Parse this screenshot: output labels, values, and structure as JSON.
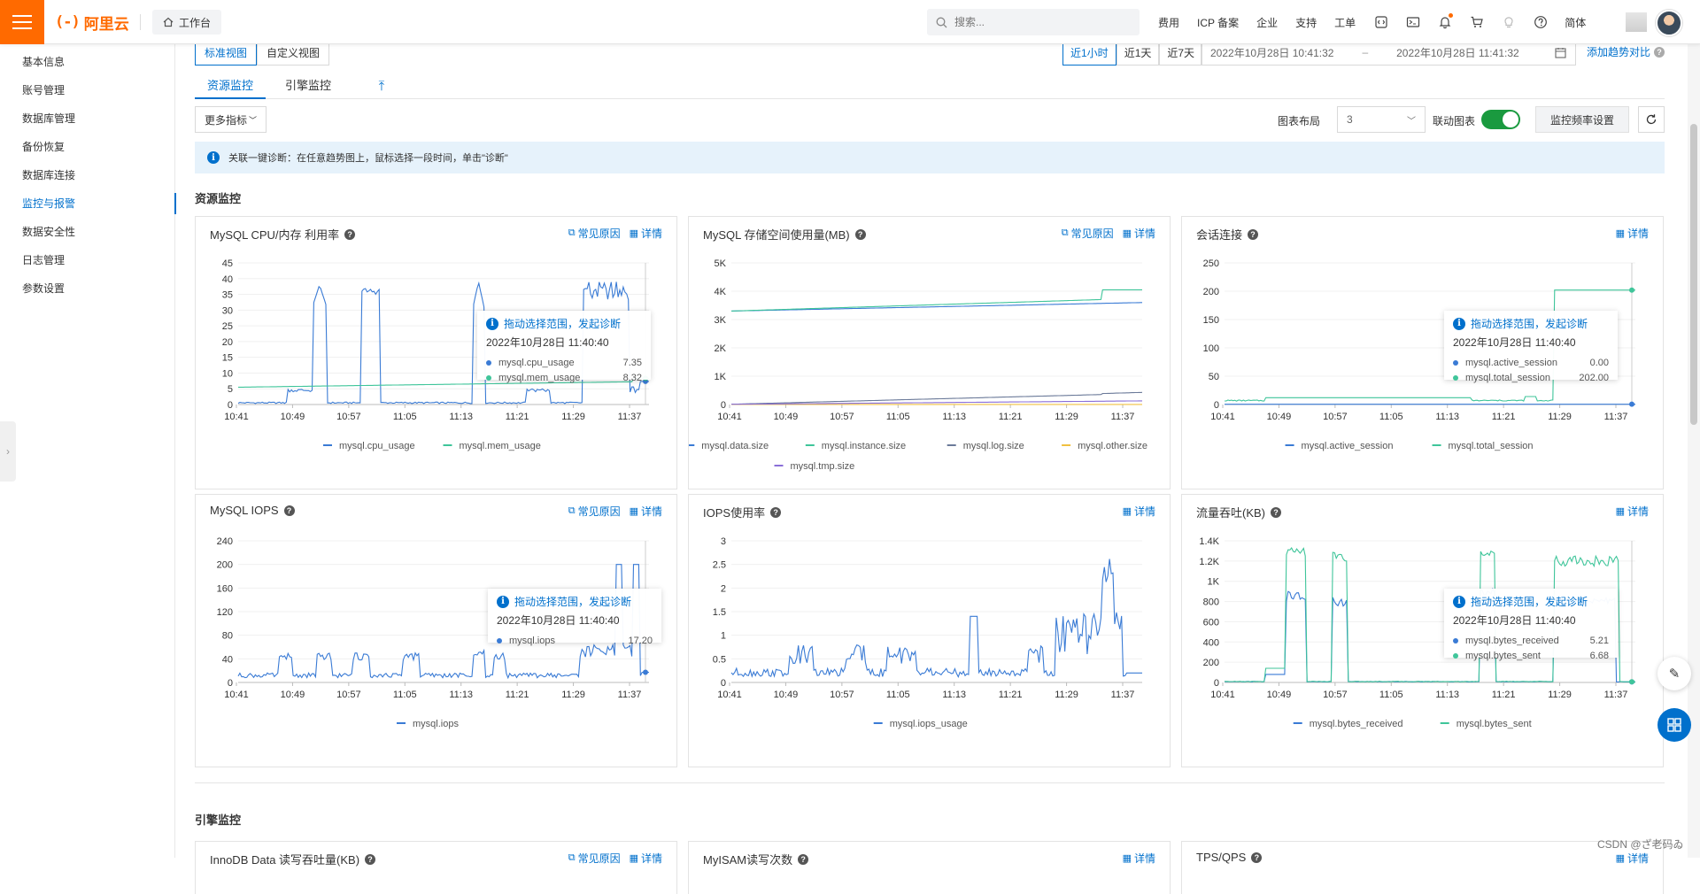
{
  "topbar": {
    "logo_mark": "(-)",
    "logo_text": "阿里云",
    "workbench": "工作台",
    "search_placeholder": "搜索...",
    "nav": [
      "费用",
      "ICP 备案",
      "企业",
      "支持",
      "工单"
    ],
    "lang": "简体",
    "icons": [
      "code-icon",
      "terminal-icon",
      "bell-icon",
      "cart-icon",
      "bulb-icon",
      "help-icon"
    ]
  },
  "sidebar": {
    "items": [
      {
        "label": "基本信息",
        "active": false
      },
      {
        "label": "账号管理",
        "active": false
      },
      {
        "label": "数据库管理",
        "active": false
      },
      {
        "label": "备份恢复",
        "active": false
      },
      {
        "label": "数据库连接",
        "active": false
      },
      {
        "label": "监控与报警",
        "active": true
      },
      {
        "label": "数据安全性",
        "active": false
      },
      {
        "label": "日志管理",
        "active": false
      },
      {
        "label": "参数设置",
        "active": false
      }
    ]
  },
  "toolbar": {
    "views": [
      "标准视图",
      "自定义视图"
    ],
    "time_ranges": [
      "近1小时",
      "近1天",
      "近7天"
    ],
    "date_start": "2022年10月28日 10:41:32",
    "date_sep": "–",
    "date_end": "2022年10月28日 11:41:32",
    "trend_compare": "添加趋势对比",
    "tabs": [
      "资源监控",
      "引擎监控"
    ],
    "more_metrics": "更多指标",
    "layout_label": "图表布局",
    "layout_value": "3",
    "link_chart_label": "联动图表",
    "link_chart_on": true,
    "freq_btn": "监控频率设置"
  },
  "notice": "关联一键诊断：在任意趋势图上，鼠标选择一段时间，单击\"诊断\"",
  "sections": {
    "resource": "资源监控",
    "engine": "引擎监控"
  },
  "common_link": "常见原因",
  "detail_link": "详情",
  "tooltip_title": "拖动选择范围，发起诊断",
  "tooltip_time": "2022年10月28日 11:40:40",
  "x_ticks": [
    "10:41",
    "10:49",
    "10:57",
    "11:05",
    "11:13",
    "11:21",
    "11:29",
    "11:37"
  ],
  "colors": {
    "blue": "#3a7bd5",
    "teal": "#3fc59a",
    "slate": "#6b7a99",
    "yellow": "#f0c040",
    "purple": "#8a6fd8",
    "accent": "#0070cc",
    "brand": "#ff6a00"
  },
  "chart_data": [
    {
      "id": "cpu",
      "type": "line",
      "title": "MySQL CPU/内存 利用率",
      "has_common": true,
      "ylim": [
        0,
        45
      ],
      "yticks": [
        "0",
        "5",
        "10",
        "15",
        "20",
        "25",
        "30",
        "35",
        "40",
        "45"
      ],
      "yvals": [
        0,
        5,
        10,
        15,
        20,
        25,
        30,
        35,
        40,
        45
      ],
      "series": [
        {
          "name": "mysql.cpu_usage",
          "color": "blue",
          "kind": "cpu"
        },
        {
          "name": "mysql.mem_usage",
          "color": "teal",
          "kind": "mem"
        }
      ],
      "tooltip": [
        {
          "name": "mysql.cpu_usage",
          "value": "7.35",
          "color": "blue"
        },
        {
          "name": "mysql.mem_usage",
          "value": "8.32",
          "color": "teal"
        }
      ]
    },
    {
      "id": "storage",
      "type": "line",
      "title": "MySQL 存储空间使用量(MB)",
      "has_common": true,
      "ylim": [
        0,
        5000
      ],
      "yticks": [
        "0",
        "1K",
        "2K",
        "3K",
        "4K",
        "5K"
      ],
      "yvals": [
        0,
        1000,
        2000,
        3000,
        4000,
        5000
      ],
      "series": [
        {
          "name": "mysql.data.size",
          "color": "blue",
          "kind": "data"
        },
        {
          "name": "mysql.instance.size",
          "color": "teal",
          "kind": "inst"
        },
        {
          "name": "mysql.log.size",
          "color": "slate",
          "kind": "log"
        },
        {
          "name": "mysql.other.size",
          "color": "yellow",
          "kind": "other"
        },
        {
          "name": "mysql.tmp.size",
          "color": "purple",
          "kind": "tmp"
        }
      ],
      "tooltip": []
    },
    {
      "id": "session",
      "type": "line",
      "title": "会话连接",
      "has_common": false,
      "ylim": [
        0,
        250
      ],
      "yticks": [
        "0",
        "50",
        "100",
        "150",
        "200",
        "250"
      ],
      "yvals": [
        0,
        50,
        100,
        150,
        200,
        250
      ],
      "series": [
        {
          "name": "mysql.active_session",
          "color": "blue",
          "kind": "active"
        },
        {
          "name": "mysql.total_session",
          "color": "teal",
          "kind": "total"
        }
      ],
      "tooltip": [
        {
          "name": "mysql.active_session",
          "value": "0.00",
          "color": "blue"
        },
        {
          "name": "mysql.total_session",
          "value": "202.00",
          "color": "teal"
        }
      ]
    },
    {
      "id": "iops",
      "type": "line",
      "title": "MySQL IOPS",
      "has_common": true,
      "ylim": [
        0,
        240
      ],
      "yticks": [
        "0",
        "40",
        "80",
        "120",
        "160",
        "200",
        "240"
      ],
      "yvals": [
        0,
        40,
        80,
        120,
        160,
        200,
        240
      ],
      "series": [
        {
          "name": "mysql.iops",
          "color": "blue",
          "kind": "iops"
        }
      ],
      "tooltip": [
        {
          "name": "mysql.iops",
          "value": "17.20",
          "color": "blue"
        }
      ]
    },
    {
      "id": "iopsusage",
      "type": "line",
      "title": "IOPS使用率",
      "has_common": false,
      "ylim": [
        0,
        3
      ],
      "yticks": [
        "0",
        "0.5",
        "1",
        "1.5",
        "2",
        "2.5",
        "3"
      ],
      "yvals": [
        0,
        0.5,
        1,
        1.5,
        2,
        2.5,
        3
      ],
      "series": [
        {
          "name": "mysql.iops_usage",
          "color": "blue",
          "kind": "iopsu"
        }
      ],
      "tooltip": []
    },
    {
      "id": "traffic",
      "type": "line",
      "title": "流量吞吐(KB)",
      "has_common": false,
      "ylim": [
        0,
        1400
      ],
      "yticks": [
        "0",
        "200",
        "400",
        "600",
        "800",
        "1K",
        "1.2K",
        "1.4K"
      ],
      "yvals": [
        0,
        200,
        400,
        600,
        800,
        1000,
        1200,
        1400
      ],
      "series": [
        {
          "name": "mysql.bytes_received",
          "color": "blue",
          "kind": "recv"
        },
        {
          "name": "mysql.bytes_sent",
          "color": "teal",
          "kind": "sent"
        }
      ],
      "tooltip": [
        {
          "name": "mysql.bytes_received",
          "value": "5.21",
          "color": "blue"
        },
        {
          "name": "mysql.bytes_sent",
          "value": "6.68",
          "color": "teal"
        }
      ]
    }
  ],
  "engine_cards": [
    {
      "title": "InnoDB Data 读写吞吐量(KB)",
      "has_common": true
    },
    {
      "title": "MyISAM读写次数",
      "has_common": false
    },
    {
      "title": "TPS/QPS",
      "has_common": false
    }
  ],
  "watermark": "CSDN @ざ老码ゐ"
}
